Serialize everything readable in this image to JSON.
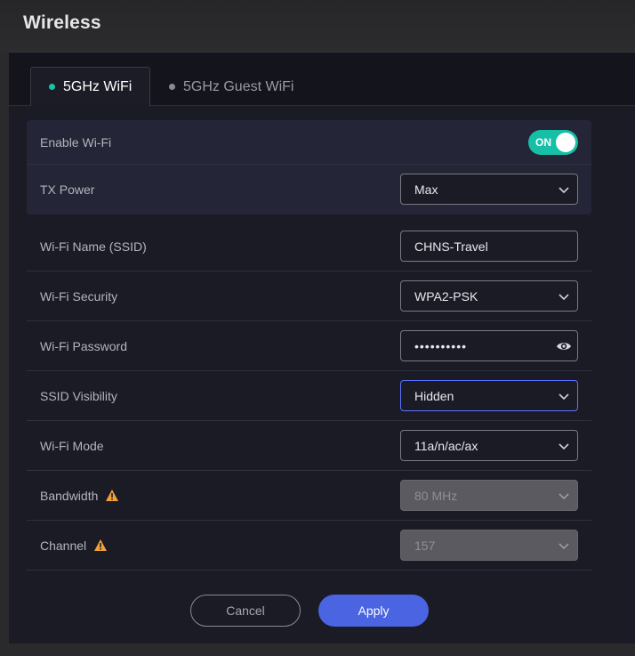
{
  "header": {
    "title": "Wireless"
  },
  "tabs": [
    {
      "label": "5GHz WiFi",
      "active": true
    },
    {
      "label": "5GHz Guest WiFi",
      "active": false
    }
  ],
  "form": {
    "enable_wifi": {
      "label": "Enable Wi-Fi",
      "toggle_text": "ON",
      "state": "on"
    },
    "tx_power": {
      "label": "TX Power",
      "value": "Max"
    },
    "ssid": {
      "label": "Wi-Fi Name (SSID)",
      "value": "CHNS-Travel"
    },
    "security": {
      "label": "Wi-Fi Security",
      "value": "WPA2-PSK"
    },
    "password": {
      "label": "Wi-Fi Password",
      "value": "••••••••••"
    },
    "ssid_visibility": {
      "label": "SSID Visibility",
      "value": "Hidden"
    },
    "wifi_mode": {
      "label": "Wi-Fi Mode",
      "value": "11a/n/ac/ax"
    },
    "bandwidth": {
      "label": "Bandwidth",
      "value": "80 MHz"
    },
    "channel": {
      "label": "Channel",
      "value": "157"
    }
  },
  "actions": {
    "cancel_label": "Cancel",
    "apply_label": "Apply"
  },
  "colors": {
    "accent_teal": "#17bfa6",
    "primary_blue": "#4a64e2",
    "warning_orange": "#f0a13a",
    "focus_blue": "#5b73ff"
  },
  "icons": {
    "dropdown": "chevron-down-icon",
    "reveal_password": "eye-icon",
    "warning": "warning-icon"
  }
}
